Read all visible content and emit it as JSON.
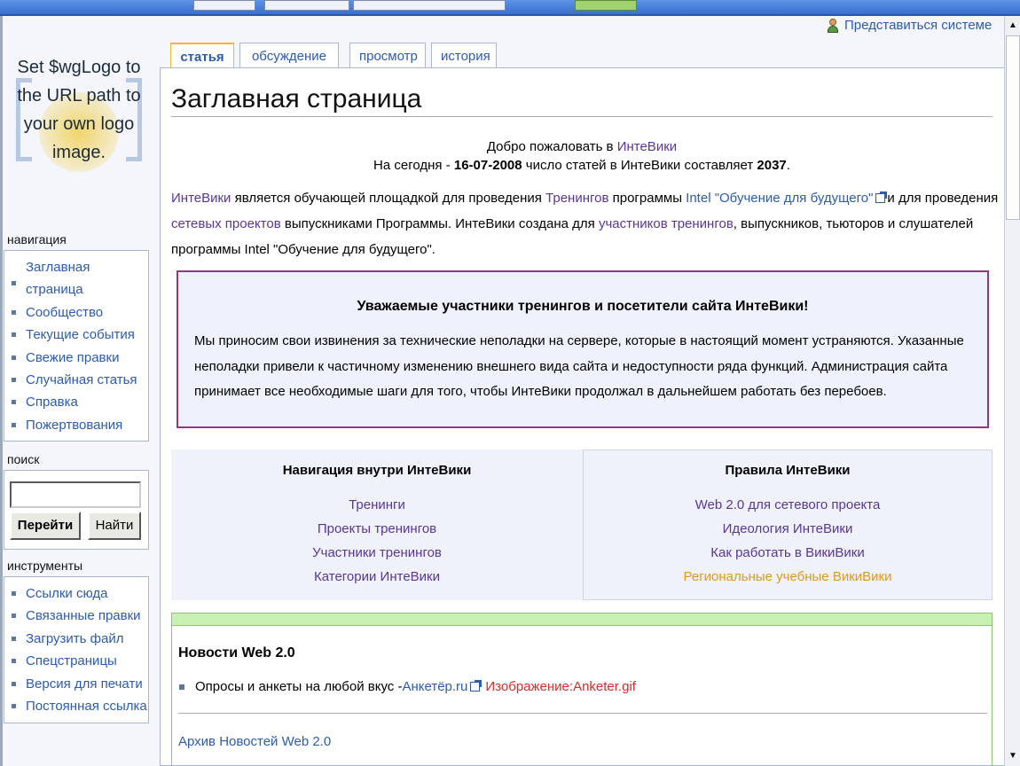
{
  "browser": {
    "accent": "#3b6fd0"
  },
  "logo": {
    "text": "Set $wgLogo to the URL path to your own logo image."
  },
  "user": {
    "login_label": "Представиться системе"
  },
  "tabs": [
    {
      "label": "статья",
      "selected": true
    },
    {
      "label": "обсуждение",
      "selected": false
    },
    {
      "label": "просмотр",
      "selected": false
    },
    {
      "label": "история",
      "selected": false
    }
  ],
  "page": {
    "title": "Заглавная страница",
    "welcome_prefix": "Добро пожаловать в ",
    "welcome_link": "ИнтеВики",
    "stats_prefix": "На сегодня - ",
    "stats_date": "16-07-2008",
    "stats_middle": " число статей в ИнтеВики составляет ",
    "stats_count": "2037",
    "stats_suffix": "."
  },
  "intro": {
    "link_intewiki": "ИнтеВики",
    "text1": " является обучающей площадкой для проведения ",
    "link_trainings": "Тренингов",
    "text2": " программы ",
    "link_intel": "Intel \"Обучение для будущего\"",
    "text3": "и для проведения ",
    "link_network": "сетевых проектов",
    "text4": " выпускниками Программы. ИнтеВики создана для ",
    "link_participants": "участников тренингов",
    "text5": ", выпускников, тьюторов и слушателей программы Intel \"Обучение для будущего\"."
  },
  "notice": {
    "title": "Уважаемые участники тренингов и посетители сайта ИнтеВики!",
    "text": "Мы приносим свои извинения за технические неполадки на сервере, которые в настоящий момент устраняются. Указанные неполадки привели к частичному изменению внешнего вида сайта и недоступности ряда функций. Администрация сайта принимает все необходимые шаги для того, чтобы ИнтеВики продолжал в дальнейшем работать без перебоев."
  },
  "panels": {
    "nav_title": "Навигация внутри ИнтеВики",
    "nav_links": [
      "Тренинги",
      "Проекты тренингов",
      "Участники тренингов",
      "Категории ИнтеВики"
    ],
    "rules_title": "Правила ИнтеВики",
    "rules_links": [
      "Web 2.0 для сетевого проекта",
      "Идеология ИнтеВики",
      "Как работать в ВикиВики",
      "Региональные учебные ВикиВики"
    ]
  },
  "news": {
    "title": "Новости Web 2.0",
    "item_text": "Опросы и анкеты на любой вкус - ",
    "item_link": "Анкетёр.ru",
    "item_image_link": "Изображение:Anketer.gif",
    "archive_link": "Архив Новостей Web 2.0"
  },
  "sidebar": {
    "nav_heading": "навигация",
    "nav_items": [
      "Заглавная страница",
      "Сообщество",
      "Текущие события",
      "Свежие правки",
      "Случайная статья",
      "Справка",
      "Пожертвования"
    ],
    "search_heading": "поиск",
    "search_value": "",
    "go_label": "Перейти",
    "find_label": "Найти",
    "tools_heading": "инструменты",
    "tools_items": [
      "Ссылки сюда",
      "Связанные правки",
      "Загрузить файл",
      "Спецстраницы",
      "Версия для печати",
      "Постоянная ссылка"
    ]
  }
}
